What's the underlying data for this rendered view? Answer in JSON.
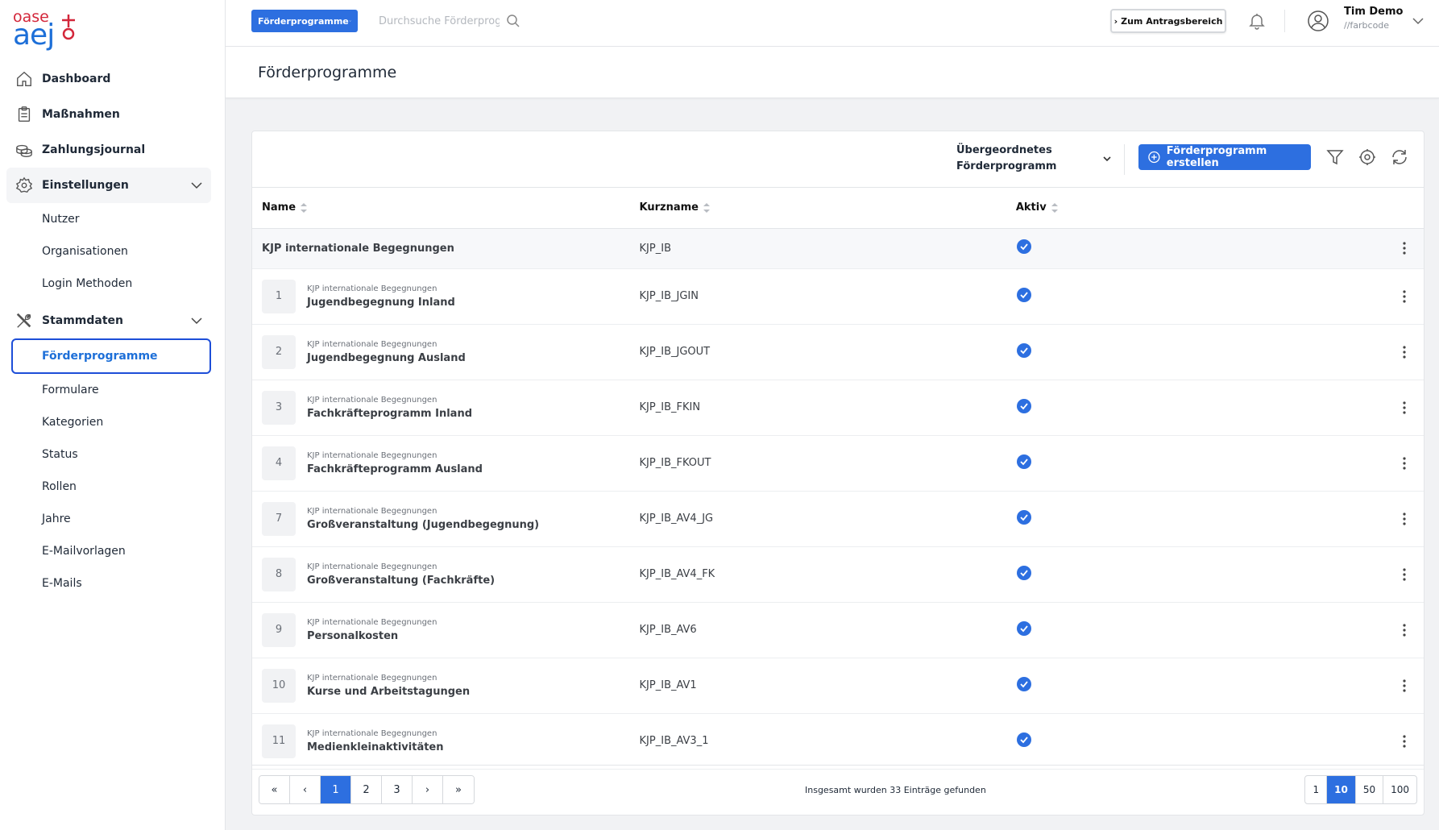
{
  "logo": {
    "top": "oase",
    "bottom": "aej"
  },
  "sidebar": {
    "items": [
      {
        "label": "Dashboard"
      },
      {
        "label": "Maßnahmen"
      },
      {
        "label": "Zahlungsjournal"
      },
      {
        "label": "Einstellungen"
      },
      {
        "label": "Stammdaten"
      }
    ],
    "einstellungen_sub": [
      "Nutzer",
      "Organisationen",
      "Login Methoden"
    ],
    "stammdaten_sub": [
      "Förderprogramme",
      "Formulare",
      "Kategorien",
      "Status",
      "Rollen",
      "Jahre",
      "E-Mailvorlagen",
      "E-Mails"
    ]
  },
  "topbar": {
    "program_button": "Förderprogramme",
    "search_placeholder": "Durchsuche Förderprog",
    "antrag_button": "Zum Antragsbereich",
    "user_name": "Tim Demo",
    "user_org": "//farbcode"
  },
  "page": {
    "title": "Förderprogramme"
  },
  "toolbar": {
    "parent_select": "Übergeordnetes Förderprogramm",
    "create_button": "Förderprogramm erstellen"
  },
  "table": {
    "columns": [
      "Name",
      "Kurzname",
      "Aktiv"
    ],
    "main_row": {
      "name": "KJP internationale Begegnungen",
      "short": "KJP_IB"
    },
    "rows": [
      {
        "num": "1",
        "parent": "KJP internationale Begegnungen",
        "name": "Jugendbegegnung Inland",
        "short": "KJP_IB_JGIN"
      },
      {
        "num": "2",
        "parent": "KJP internationale Begegnungen",
        "name": "Jugendbegegnung Ausland",
        "short": "KJP_IB_JGOUT"
      },
      {
        "num": "3",
        "parent": "KJP internationale Begegnungen",
        "name": "Fachkräfteprogramm Inland",
        "short": "KJP_IB_FKIN"
      },
      {
        "num": "4",
        "parent": "KJP internationale Begegnungen",
        "name": "Fachkräfteprogramm Ausland",
        "short": "KJP_IB_FKOUT"
      },
      {
        "num": "7",
        "parent": "KJP internationale Begegnungen",
        "name": "Großveranstaltung (Jugendbegegnung)",
        "short": "KJP_IB_AV4_JG"
      },
      {
        "num": "8",
        "parent": "KJP internationale Begegnungen",
        "name": "Großveranstaltung (Fachkräfte)",
        "short": "KJP_IB_AV4_FK"
      },
      {
        "num": "9",
        "parent": "KJP internationale Begegnungen",
        "name": "Personalkosten",
        "short": "KJP_IB_AV6"
      },
      {
        "num": "10",
        "parent": "KJP internationale Begegnungen",
        "name": "Kurse und Arbeitstagungen",
        "short": "KJP_IB_AV1"
      },
      {
        "num": "11",
        "parent": "KJP internationale Begegnungen",
        "name": "Medienkleinaktivitäten",
        "short": "KJP_IB_AV3_1"
      }
    ]
  },
  "footer": {
    "pages": [
      "1",
      "2",
      "3"
    ],
    "total_text": "Insgesamt wurden 33 Einträge gefunden",
    "page_sizes": [
      "1",
      "10",
      "50",
      "100"
    ]
  },
  "colors": {
    "accent": "#2d6fe0",
    "logo_red": "#d3263a",
    "logo_blue": "#1d6fd8"
  }
}
